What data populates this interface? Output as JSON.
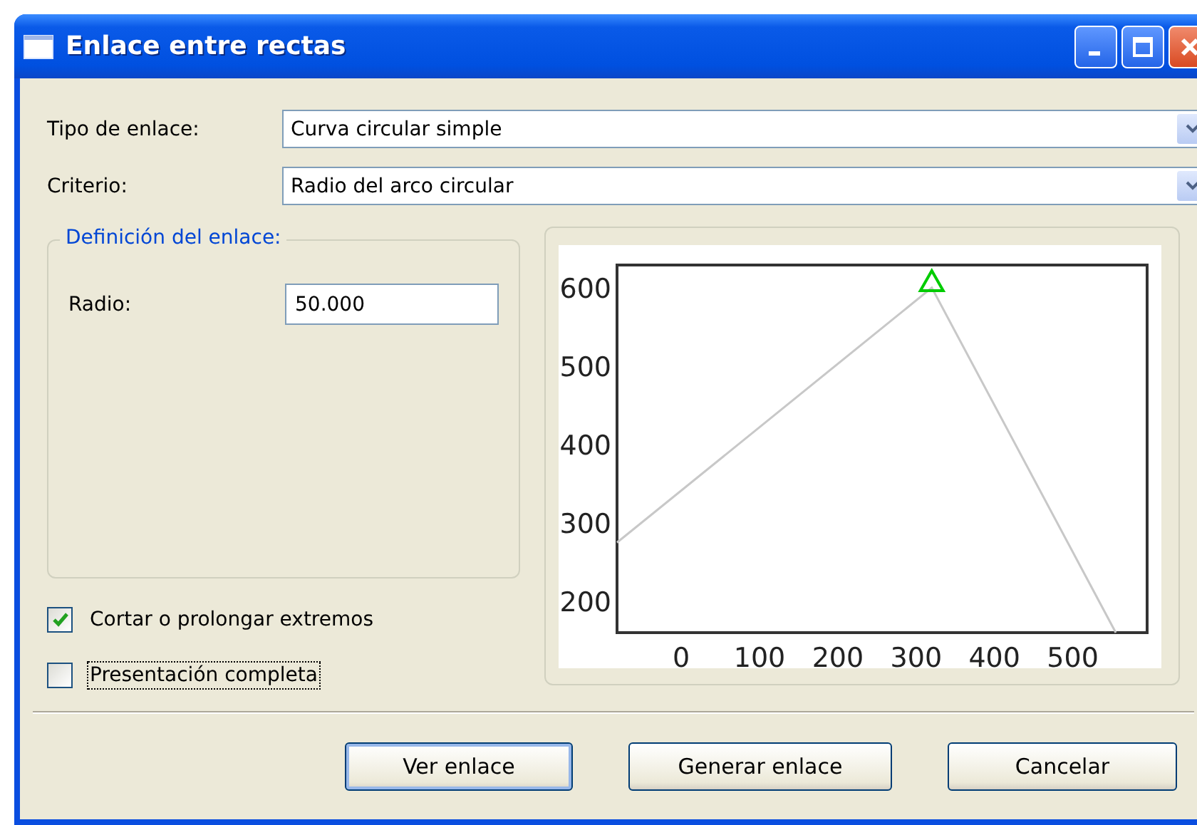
{
  "window": {
    "title": "Enlace entre rectas"
  },
  "fields": [
    {
      "label": "Tipo de enlace:",
      "value": "Curva circular simple"
    },
    {
      "label": "Criterio:",
      "value": "Radio del arco circular"
    }
  ],
  "definition": {
    "title": "Definición del enlace:",
    "label": "Radio:",
    "value": "50.000"
  },
  "checkboxes": [
    {
      "label": "Cortar o prolongar extremos",
      "checked": true,
      "focused": false
    },
    {
      "label": "Presentación completa",
      "checked": false,
      "focused": true
    }
  ],
  "preview": {
    "chart_data": {
      "type": "line",
      "x": [
        -82,
        320,
        555
      ],
      "series": [
        {
          "color": "#c8c8c8",
          "values": [
            275,
            600,
            160
          ]
        }
      ],
      "xlim": [
        -82,
        595
      ],
      "ylim": [
        160,
        629
      ],
      "xticks": [
        0,
        100,
        200,
        300,
        400,
        500
      ],
      "yticks": [
        200,
        300,
        400,
        500,
        600
      ]
    }
  },
  "buttons": [
    "Ver enlace",
    "Generar enlace",
    "Cancelar"
  ]
}
